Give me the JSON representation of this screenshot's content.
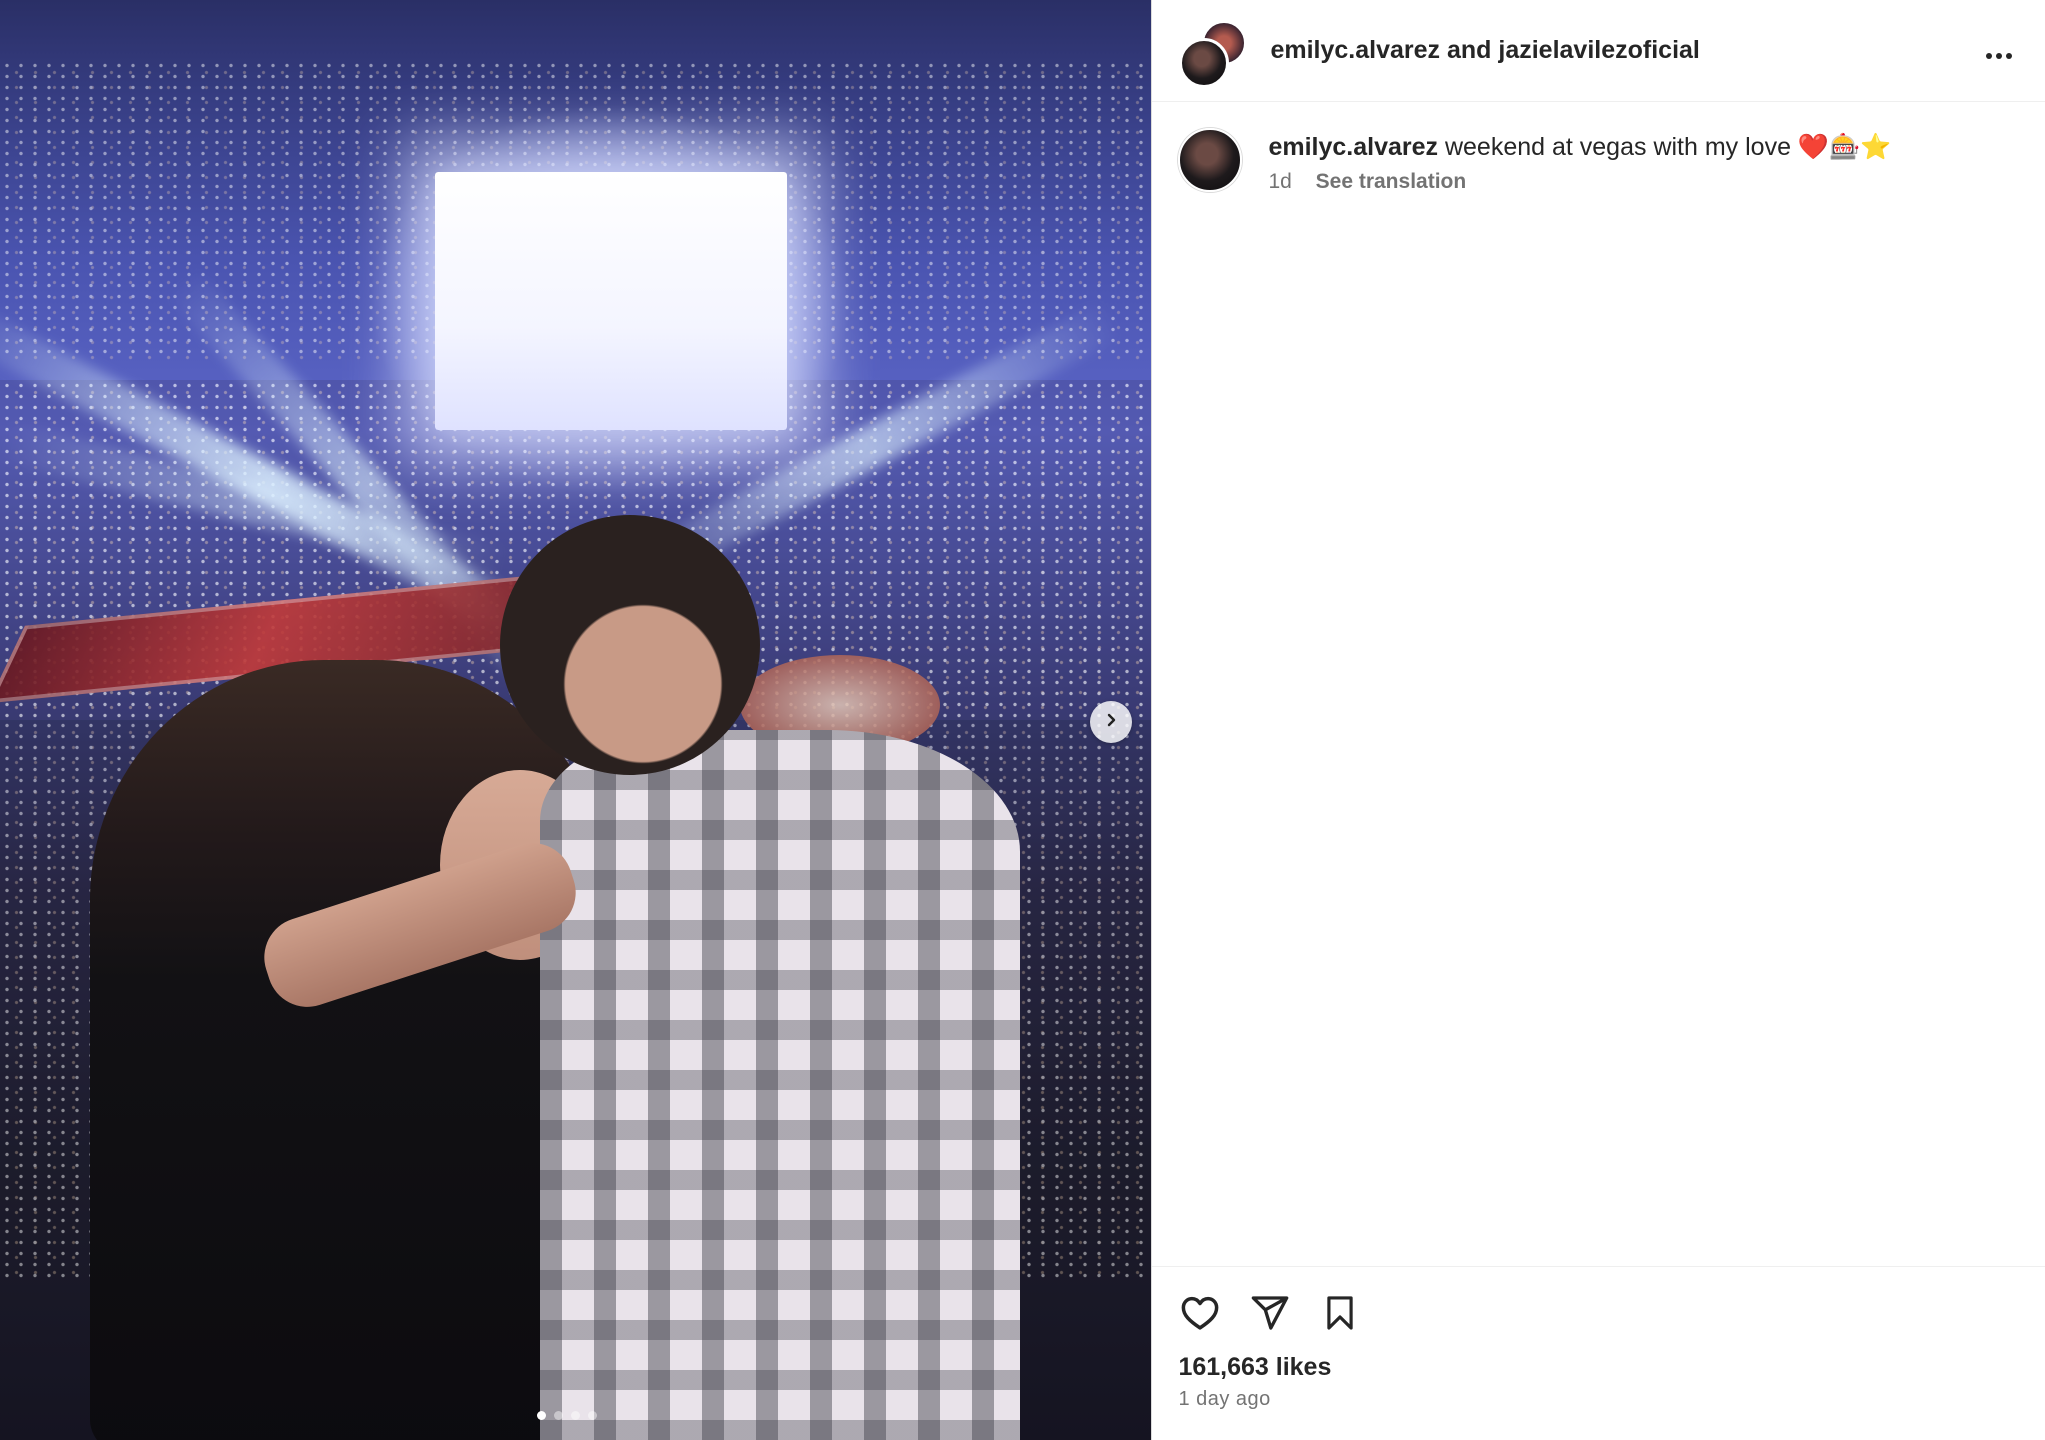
{
  "header": {
    "author": "emilyc.alvarez",
    "joiner": "and",
    "collaborator": "jazielavilezoficial",
    "more_icon": "more-horizontal-icon"
  },
  "media": {
    "next_icon": "chevron-right-icon",
    "carousel_count": 4,
    "carousel_active_index": 0
  },
  "caption": {
    "username": "emilyc.alvarez",
    "text": "weekend at vegas with my love ❤️🎰⭐️",
    "age": "1d",
    "translate_label": "See translation"
  },
  "actions": {
    "like_icon": "heart-icon",
    "share_icon": "paper-plane-icon",
    "save_icon": "bookmark-icon",
    "likes_label": "161,663 likes",
    "timestamp": "1 day ago"
  }
}
